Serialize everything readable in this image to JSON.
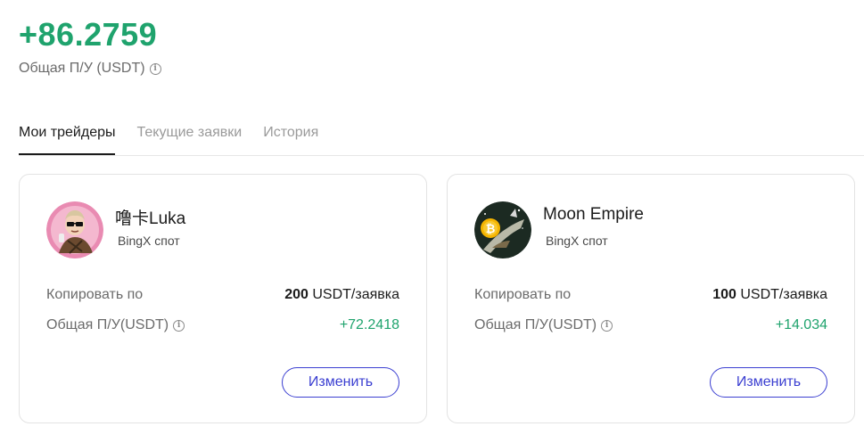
{
  "summary": {
    "total_pnl": "+86.2759",
    "total_pnl_label": "Общая П/У (USDT)"
  },
  "tabs": [
    {
      "label": "Мои трейдеры",
      "active": true
    },
    {
      "label": "Текущие заявки",
      "active": false
    },
    {
      "label": "История",
      "active": false
    }
  ],
  "traders": [
    {
      "name": "噜卡Luka",
      "type": "BingX спот",
      "copy_label": "Копировать по",
      "copy_amount": "200",
      "copy_unit": " USDT/заявка",
      "pnl_label": "Общая П/У(USDT)",
      "pnl_value": "+72.2418",
      "edit_label": "Изменить"
    },
    {
      "name": "Moon Empire",
      "type": "BingX спот",
      "copy_label": "Копировать по",
      "copy_amount": "100",
      "copy_unit": " USDT/заявка",
      "pnl_label": "Общая П/У(USDT)",
      "pnl_value": "+14.034",
      "edit_label": "Изменить"
    }
  ],
  "colors": {
    "positive": "#1fa36d",
    "accent": "#3b3fd1"
  }
}
